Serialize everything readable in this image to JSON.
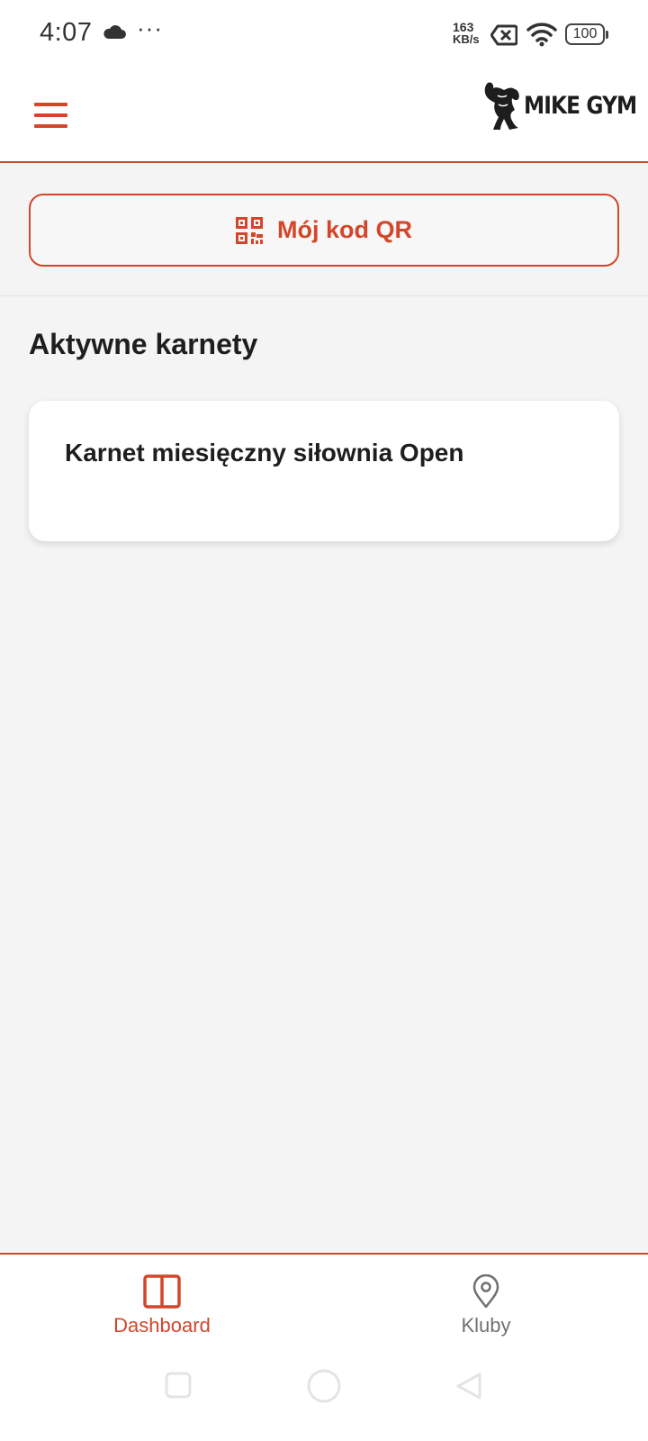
{
  "status_bar": {
    "time": "4:07",
    "overflow_dots": "···",
    "speed_value": "163",
    "speed_unit": "KB/s",
    "battery": "100"
  },
  "header": {
    "menu_icon": "hamburger-menu-icon",
    "logo_text": "MIKE GYM"
  },
  "qr_button": {
    "label": "Mój kod QR",
    "icon": "qr-code-icon"
  },
  "main": {
    "section_title": "Aktywne karnety",
    "passes": [
      {
        "name": "Karnet miesięczny siłownia Open"
      }
    ]
  },
  "bottom_nav": {
    "items": [
      {
        "label": "Dashboard",
        "icon": "dashboard-columns-icon",
        "active": true
      },
      {
        "label": "Kluby",
        "icon": "location-pin-icon",
        "active": false
      }
    ]
  },
  "colors": {
    "accent": "#d3462a",
    "background": "#f4f4f4",
    "card": "#ffffff",
    "inactive_nav": "#707070"
  }
}
